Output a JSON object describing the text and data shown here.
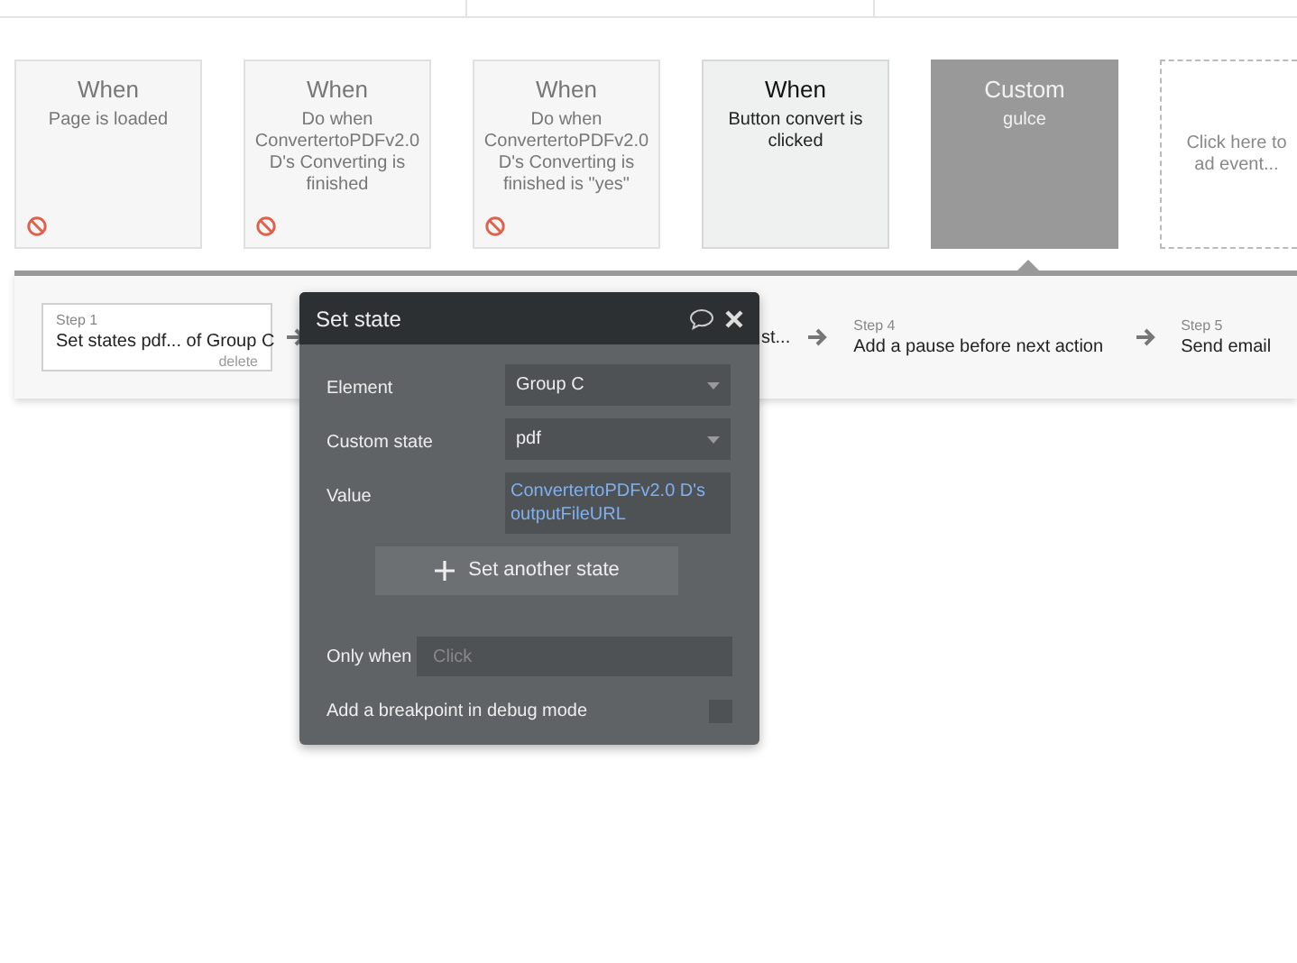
{
  "events": [
    {
      "kind": "event",
      "title": "When",
      "description": "Page is loaded",
      "disabled": true,
      "selected": false
    },
    {
      "kind": "event",
      "title": "When",
      "description": "Do when ConvertertoPDFv2.0 D's Converting is finished",
      "disabled": true,
      "selected": false
    },
    {
      "kind": "event",
      "title": "When",
      "description": "Do when ConvertertoPDFv2.0 D's Converting is finished is \"yes\"",
      "disabled": true,
      "selected": false
    },
    {
      "kind": "event",
      "title": "When",
      "description": "Button convert is clicked",
      "disabled": false,
      "selected": false
    },
    {
      "kind": "custom",
      "title": "Custom",
      "description": "gulce",
      "disabled": false,
      "selected": true
    },
    {
      "kind": "add",
      "description": "Click here to ad event..."
    }
  ],
  "steps": [
    {
      "kind": "step",
      "step": "Step 1",
      "label": "Set states pdf... of Group C",
      "delete": "delete"
    },
    {
      "kind": "hidden",
      "label": "st..."
    },
    {
      "kind": "step",
      "step": "Step 4",
      "label": "Add a pause before next action"
    },
    {
      "kind": "step",
      "step": "Step 5",
      "label": "Send email"
    }
  ],
  "popup": {
    "title": "Set state",
    "fields": [
      {
        "kind": "dropdown",
        "label": "Element",
        "value": "Group C"
      },
      {
        "kind": "dropdown",
        "label": "Custom state",
        "value": "pdf"
      },
      {
        "kind": "expression",
        "label": "Value",
        "value": "ConvertertoPDFv2.0 D's outputFileURL"
      }
    ],
    "add_button": "Set another state",
    "only_when": {
      "label": "Only when",
      "placeholder": "Click"
    },
    "breakpoint": {
      "label": "Add a breakpoint in debug mode",
      "checked": false
    }
  }
}
